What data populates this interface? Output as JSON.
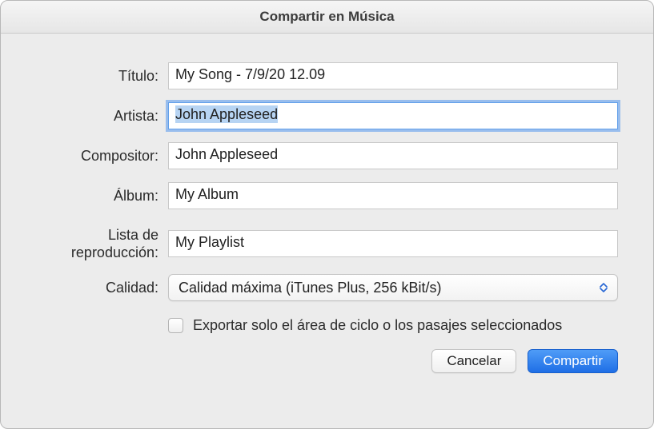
{
  "window": {
    "title": "Compartir en Música"
  },
  "labels": {
    "title": "Título:",
    "artist": "Artista:",
    "composer": "Compositor:",
    "album": "Álbum:",
    "playlist_line1": "Lista de",
    "playlist_line2": "reproducción:",
    "quality": "Calidad:"
  },
  "fields": {
    "title": "My Song - 7/9/20 12.09",
    "artist": "John Appleseed",
    "composer": "John Appleseed",
    "album": "My Album",
    "playlist": "My Playlist",
    "quality_selected": "Calidad máxima (iTunes Plus, 256 kBit/s)"
  },
  "checkbox": {
    "export_cycle": "Exportar solo el área de ciclo o los pasajes seleccionados",
    "checked": false
  },
  "buttons": {
    "cancel": "Cancelar",
    "share": "Compartir"
  }
}
